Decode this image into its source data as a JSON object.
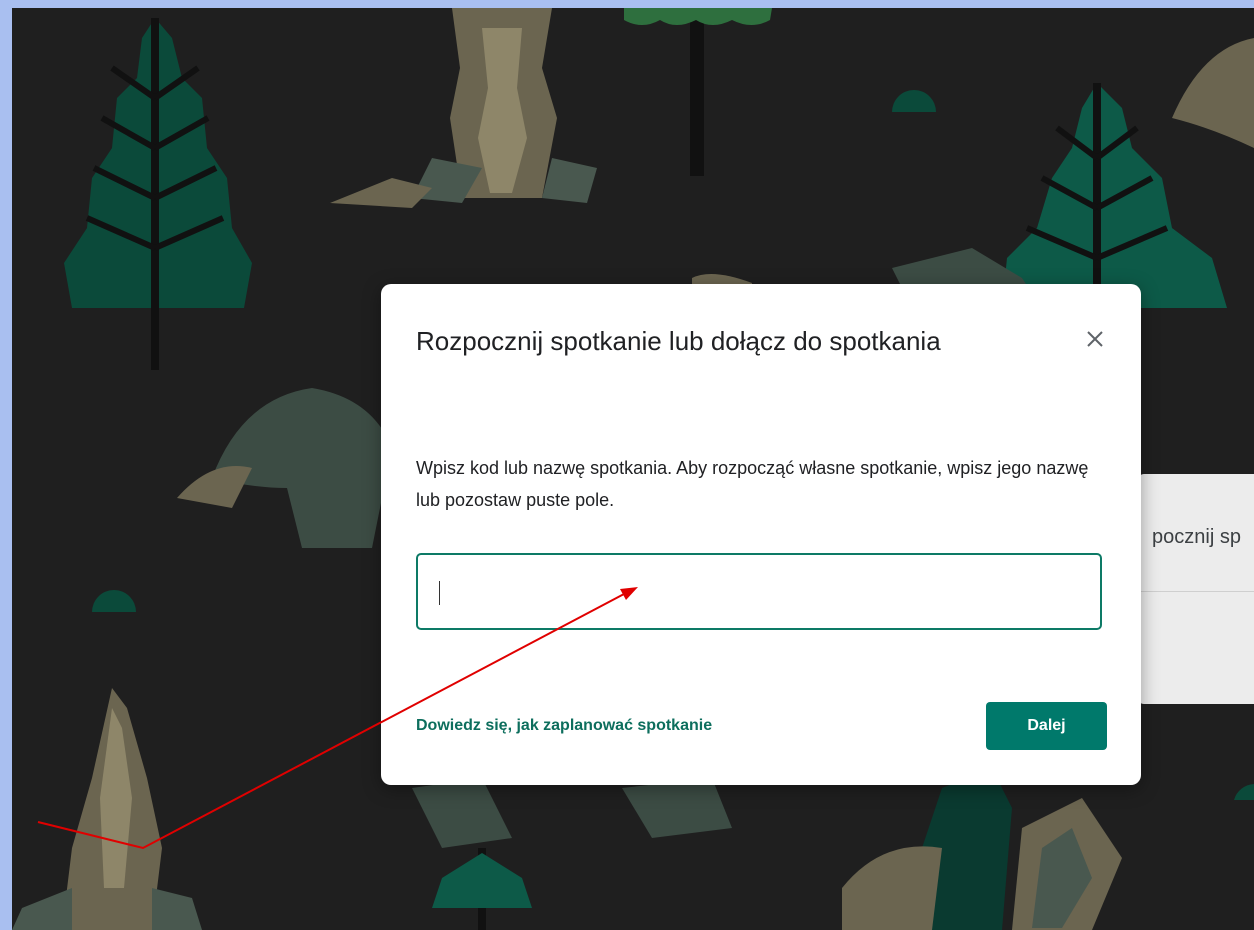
{
  "dialog": {
    "title": "Rozpocznij spotkanie lub dołącz do spotkania",
    "description": "Wpisz kod lub nazwę spotkania. Aby rozpocząć własne spotkanie, wpisz jego nazwę lub pozostaw puste pole.",
    "input_value": "",
    "learn_link": "Dowiedz się, jak zaplanować spotkanie",
    "next_label": "Dalej",
    "close_icon": "close-icon"
  },
  "side_card": {
    "partial_text": "pocznij sp"
  },
  "colors": {
    "accent": "#00796b",
    "link": "#0d6e5d",
    "background": "#1f1f1f",
    "frame": "#a9bff0",
    "annotation_arrow": "#e00000"
  }
}
